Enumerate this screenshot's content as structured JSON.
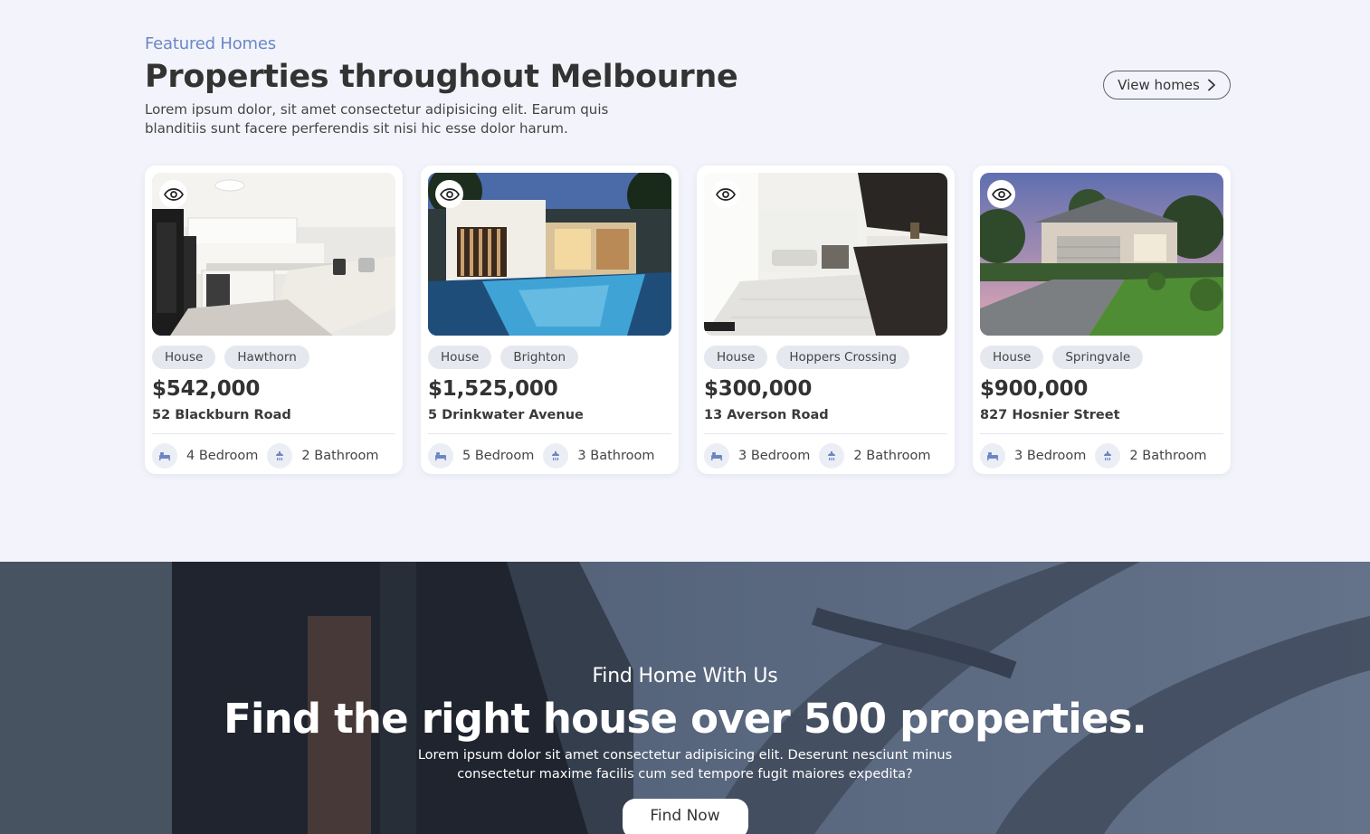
{
  "featured": {
    "eyebrow": "Featured Homes",
    "title": "Properties throughout Melbourne",
    "description": "Lorem ipsum dolor, sit amet consectetur adipisicing elit. Earum quis blanditiis sunt facere perferendis sit nisi hic esse dolor harum.",
    "view_button": "View homes"
  },
  "listings": [
    {
      "type": "House",
      "suburb": "Hawthorn",
      "price": "$542,000",
      "address": "52 Blackburn Road",
      "bedrooms": "4 Bedroom",
      "bathrooms": "2 Bathroom"
    },
    {
      "type": "House",
      "suburb": "Brighton",
      "price": "$1,525,000",
      "address": "5 Drinkwater Avenue",
      "bedrooms": "5 Bedroom",
      "bathrooms": "3 Bathroom"
    },
    {
      "type": "House",
      "suburb": "Hoppers Crossing",
      "price": "$300,000",
      "address": "13 Averson Road",
      "bedrooms": "3 Bedroom",
      "bathrooms": "2 Bathroom"
    },
    {
      "type": "House",
      "suburb": "Springvale",
      "price": "$900,000",
      "address": "827 Hosnier Street",
      "bedrooms": "3 Bedroom",
      "bathrooms": "2 Bathroom"
    }
  ],
  "hero": {
    "eyebrow": "Find Home With Us",
    "title": "Find the right house over 500 properties.",
    "description": "Lorem ipsum dolor sit amet consectetur adipisicing elit. Deserunt nesciunt minus consectetur maxime facilis cum sed tempore fugit maiores expedita?",
    "button": "Find Now"
  },
  "icons": [
    "eye-icon",
    "bed-icon",
    "bathroom-icon",
    "chevron-right-icon"
  ],
  "colors": {
    "accent": "#6b86c4",
    "background": "#f3f4fb",
    "text": "#333333"
  }
}
